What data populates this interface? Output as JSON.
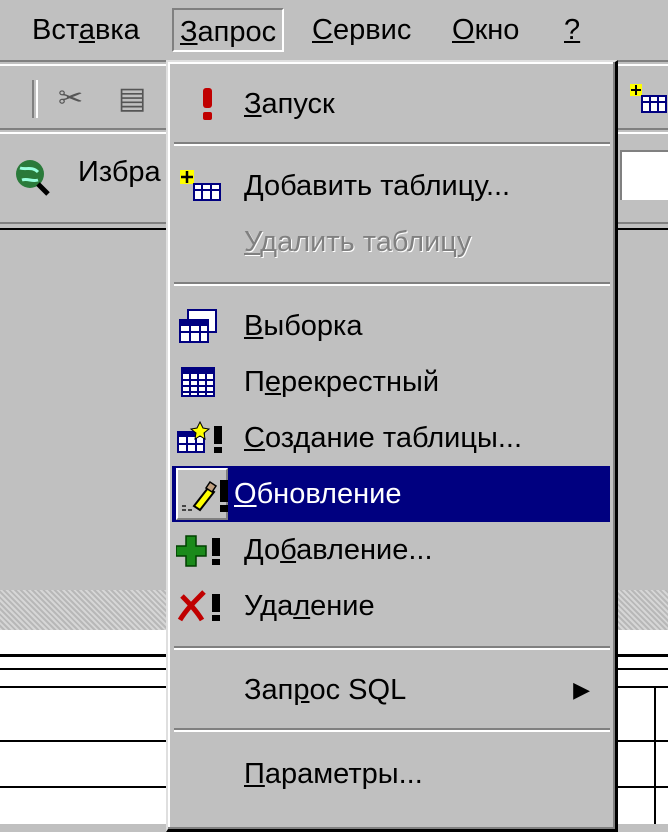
{
  "menubar": {
    "items": [
      {
        "pre": "Вст",
        "key": "а",
        "post": "вка"
      },
      {
        "pre": "",
        "key": "З",
        "post": "апрос"
      },
      {
        "pre": "",
        "key": "С",
        "post": "ервис"
      },
      {
        "pre": "",
        "key": "О",
        "post": "кно"
      },
      {
        "pre": "",
        "key": "?",
        "post": ""
      }
    ]
  },
  "favbar": {
    "text": "Избра"
  },
  "dropdown": {
    "items": [
      {
        "pre": "",
        "key": "З",
        "post": "апуск",
        "icon": "run-exclamation-icon"
      },
      {
        "pre": "",
        "key": "Д",
        "post": "обавить таблицу...",
        "icon": "add-table-icon"
      },
      {
        "pre": "",
        "key": "У",
        "post": "далить таблицу",
        "icon": ""
      },
      {
        "pre": "",
        "key": "В",
        "post": "ыборка",
        "icon": "select-query-icon"
      },
      {
        "pre": "П",
        "key": "е",
        "post": "рекрестный",
        "icon": "crosstab-query-icon"
      },
      {
        "pre": "",
        "key": "С",
        "post": "оздание таблицы...",
        "icon": "make-table-query-icon"
      },
      {
        "pre": "",
        "key": "О",
        "post": "бновление",
        "icon": "update-query-icon"
      },
      {
        "pre": "До",
        "key": "б",
        "post": "авление...",
        "icon": "append-query-icon"
      },
      {
        "pre": "Уда",
        "key": "л",
        "post": "ение",
        "icon": "delete-query-icon"
      },
      {
        "pre": "Зап",
        "key": "р",
        "post": "ос SQL",
        "icon": ""
      },
      {
        "pre": "",
        "key": "П",
        "post": "араметры...",
        "icon": ""
      }
    ],
    "submenu_arrow": "▶"
  }
}
